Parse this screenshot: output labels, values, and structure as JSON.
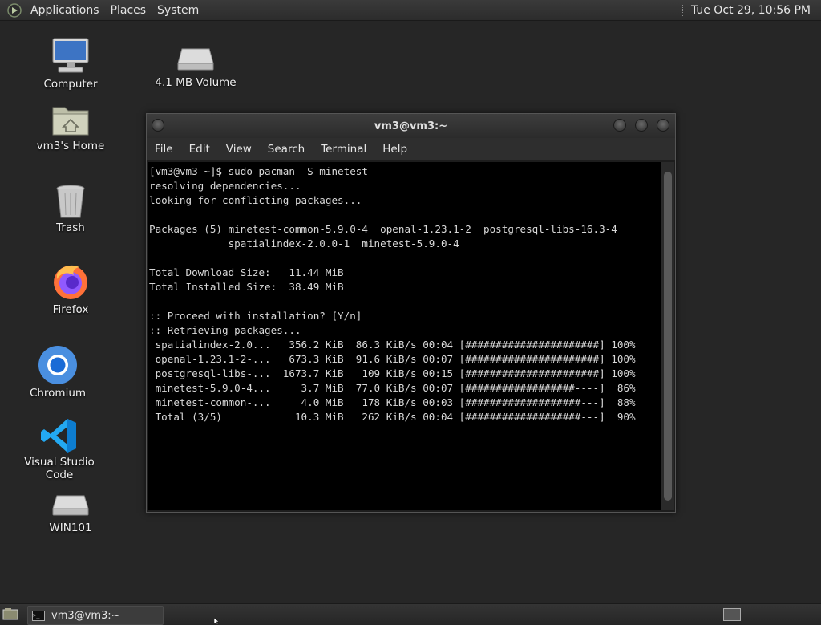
{
  "top_panel": {
    "menus": [
      "Applications",
      "Places",
      "System"
    ],
    "clock": "Tue Oct 29, 10:56 PM"
  },
  "desktop_icons": [
    {
      "label": "Computer",
      "icon": "computer-icon"
    },
    {
      "label": "4.1 MB Volume",
      "icon": "drive-icon"
    },
    {
      "label": "vm3's Home",
      "icon": "home-folder-icon"
    },
    {
      "label": "Trash",
      "icon": "trash-icon"
    },
    {
      "label": "Firefox",
      "icon": "firefox-icon"
    },
    {
      "label": "Chromium",
      "icon": "chromium-icon"
    },
    {
      "label": "Visual Studio Code",
      "icon": "vscode-icon"
    },
    {
      "label": "WIN101",
      "icon": "drive-icon"
    }
  ],
  "terminal": {
    "title": "vm3@vm3:~",
    "menu": [
      "File",
      "Edit",
      "View",
      "Search",
      "Terminal",
      "Help"
    ],
    "output": "[vm3@vm3 ~]$ sudo pacman -S minetest\nresolving dependencies...\nlooking for conflicting packages...\n\nPackages (5) minetest-common-5.9.0-4  openal-1.23.1-2  postgresql-libs-16.3-4\n             spatialindex-2.0.0-1  minetest-5.9.0-4\n\nTotal Download Size:   11.44 MiB\nTotal Installed Size:  38.49 MiB\n\n:: Proceed with installation? [Y/n]\n:: Retrieving packages...\n spatialindex-2.0...   356.2 KiB  86.3 KiB/s 00:04 [######################] 100%\n openal-1.23.1-2-...   673.3 KiB  91.6 KiB/s 00:07 [######################] 100%\n postgresql-libs-...  1673.7 KiB   109 KiB/s 00:15 [######################] 100%\n minetest-5.9.0-4...     3.7 MiB  77.0 KiB/s 00:07 [##################----]  86%\n minetest-common-...     4.0 MiB   178 KiB/s 00:03 [###################---]  88%\n Total (3/5)            10.3 MiB   262 KiB/s 00:04 [###################---]  90%"
  },
  "taskbar": {
    "tasks": [
      {
        "label": "vm3@vm3:~",
        "icon": "terminal-icon"
      }
    ]
  }
}
